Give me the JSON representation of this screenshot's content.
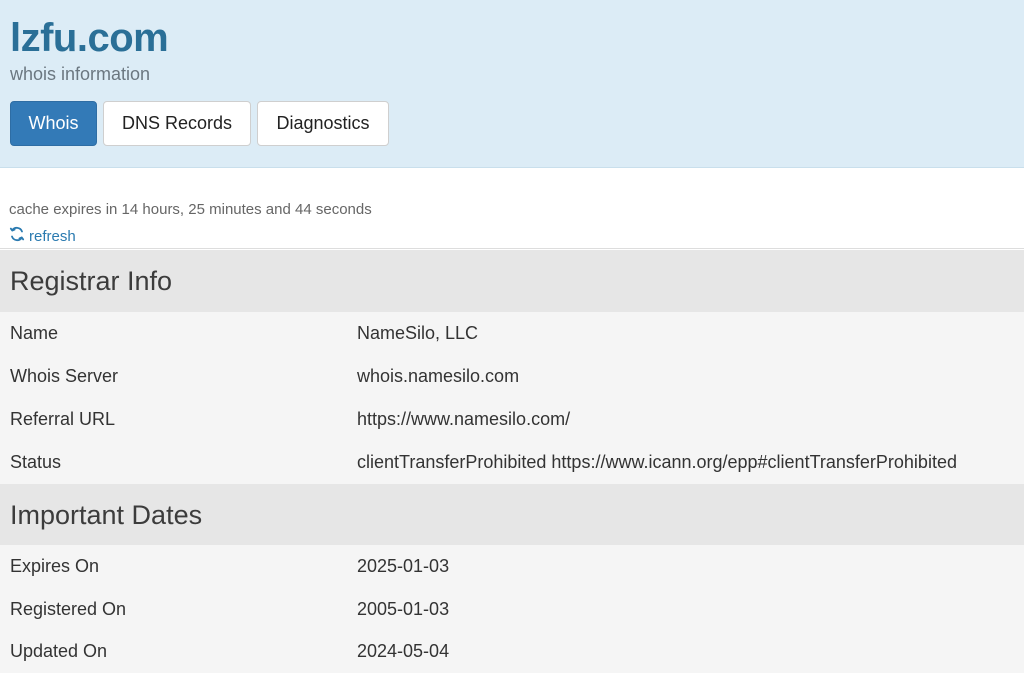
{
  "header": {
    "domain": "lzfu.com",
    "subtitle": "whois information",
    "tabs": [
      {
        "label": "Whois",
        "active": true
      },
      {
        "label": "DNS Records",
        "active": false
      },
      {
        "label": "Diagnostics",
        "active": false
      }
    ]
  },
  "cache": {
    "message": "cache expires in 14 hours, 25 minutes and 44 seconds",
    "refresh_label": "refresh",
    "refresh_icon": "refresh-icon"
  },
  "registrar": {
    "title": "Registrar Info",
    "rows": [
      {
        "key": "Name",
        "value": "NameSilo, LLC"
      },
      {
        "key": "Whois Server",
        "value": "whois.namesilo.com"
      },
      {
        "key": "Referral URL",
        "value": "https://www.namesilo.com/"
      },
      {
        "key": "Status",
        "value": "clientTransferProhibited https://www.icann.org/epp#clientTransferProhibited"
      }
    ]
  },
  "dates": {
    "title": "Important Dates",
    "rows": [
      {
        "key": "Expires On",
        "value": "2025-01-03"
      },
      {
        "key": "Registered On",
        "value": "2005-01-03"
      },
      {
        "key": "Updated On",
        "value": "2024-05-04"
      }
    ]
  },
  "colors": {
    "header_bg": "#dcecf6",
    "accent": "#337ab7",
    "title": "#2a6f97",
    "link": "#2a7ab0"
  }
}
